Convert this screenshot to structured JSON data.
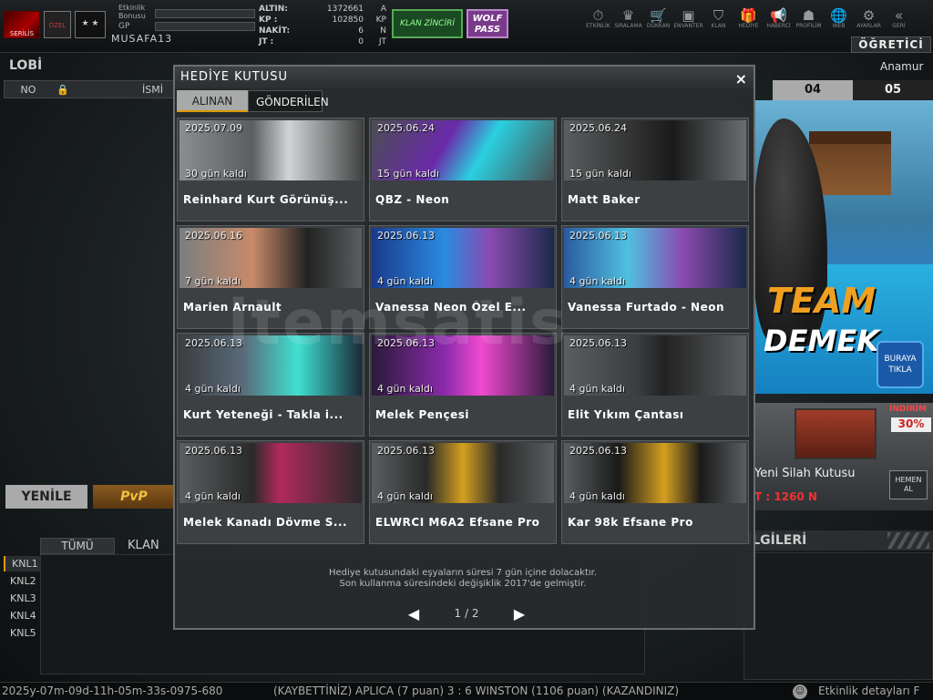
{
  "topbar": {
    "logo_text": "SERİLİS",
    "rank_badge": "ÖZEL",
    "stars": "★ ★",
    "event_bonus_label": "Etkinlik Bonusu",
    "gp_label": "GP",
    "username": "MUSAFA13",
    "currency": [
      {
        "key": "ALTIN:",
        "value": "1372661",
        "unit": "A"
      },
      {
        "key": "KP :",
        "value": "102850",
        "unit": "KP"
      },
      {
        "key": "NAKİT:",
        "value": "6",
        "unit": "N"
      },
      {
        "key": "JT :",
        "value": "0",
        "unit": "JT"
      }
    ],
    "klan_button": "KLAN ZİNCİRİ",
    "wolf_pass_button": "WOLF PASS",
    "nav": [
      {
        "label": "ETKİNLİK",
        "icon": "clock-icon"
      },
      {
        "label": "SIRALAMA",
        "icon": "ranking-icon"
      },
      {
        "label": "DÜKKAN",
        "icon": "cart-icon"
      },
      {
        "label": "ENVANTER",
        "icon": "inventory-icon"
      },
      {
        "label": "KLAN",
        "icon": "shield-icon"
      },
      {
        "label": "HEDİYE",
        "icon": "gift-icon"
      },
      {
        "label": "HABERCİ",
        "icon": "megaphone-icon"
      },
      {
        "label": "PROFİLİM",
        "icon": "profile-icon"
      },
      {
        "label": "WEB",
        "icon": "globe-icon"
      },
      {
        "label": "AYARLAR",
        "icon": "gear-icon"
      },
      {
        "label": "GERİ",
        "icon": "back-icon"
      }
    ],
    "tutorial_button": "ÖĞRETİCİ"
  },
  "lobby": {
    "title": "LOBİ",
    "server": "Anamur",
    "col_no": "NO",
    "col_name": "İSMİ",
    "room_tabs": [
      "04",
      "05"
    ],
    "refresh_button": "YENİLE",
    "mode_button": "PvP",
    "chat_tabs": [
      "TÜMÜ",
      "KLAN"
    ],
    "channels": [
      "KNL1",
      "KNL2",
      "KNL3",
      "KNL4",
      "KNL5"
    ],
    "info_header": "İLGİLERİ"
  },
  "promo": {
    "banner_line1": "TEAM",
    "banner_line2": "DEMEK",
    "click_here": "BURAYA TIKLA",
    "discount_label": "İNDİRİM",
    "discount_value": "30%",
    "item_name": "Yeni Silah Kutusu",
    "price": "T : 1260 N",
    "buy_now": "HEMEN AL"
  },
  "modal": {
    "title": "HEDİYE KUTUSU",
    "close": "×",
    "tabs": [
      {
        "label": "ALINAN",
        "active": true
      },
      {
        "label": "GÖNDERİLEN",
        "active": false
      }
    ],
    "items": [
      {
        "date": "2025.07.09",
        "left": "30 gün kaldı",
        "name": "Reinhard Kurt Görünüş..."
      },
      {
        "date": "2025.06.24",
        "left": "15 gün kaldı",
        "name": "QBZ - Neon"
      },
      {
        "date": "2025.06.24",
        "left": "15 gün kaldı",
        "name": "Matt Baker"
      },
      {
        "date": "2025.06.16",
        "left": "7 gün kaldı",
        "name": "Marien Arnault"
      },
      {
        "date": "2025.06.13",
        "left": "4 gün kaldı",
        "name": "Vanessa Neon Özel E..."
      },
      {
        "date": "2025.06.13",
        "left": "4 gün kaldı",
        "name": "Vanessa Furtado - Neon"
      },
      {
        "date": "2025.06.13",
        "left": "4 gün kaldı",
        "name": "Kurt Yeteneği - Takla i..."
      },
      {
        "date": "2025.06.13",
        "left": "4 gün kaldı",
        "name": "Melek Pençesi"
      },
      {
        "date": "2025.06.13",
        "left": "4 gün kaldı",
        "name": "Elit Yıkım Çantası"
      },
      {
        "date": "2025.06.13",
        "left": "4 gün kaldı",
        "name": "Melek Kanadı Dövme S..."
      },
      {
        "date": "2025.06.13",
        "left": "4 gün kaldı",
        "name": "ELWRCI M6A2 Efsane Pro"
      },
      {
        "date": "2025.06.13",
        "left": "4 gün kaldı",
        "name": "Kar 98k Efsane Pro"
      }
    ],
    "footnote_line1": "Hediye kutusundaki eşyaların süresi 7 gün içine dolacaktır.",
    "footnote_line2": "Son kullanma süresindeki değişiklik 2017'de gelmiştir.",
    "page": "1 / 2"
  },
  "watermark": "itemsatis",
  "ticker": {
    "timestamp": "2025y-07m-09d-11h-05m-33s-0975-680",
    "message": "(KAYBETTİNİZ) APLICA (7 puan) 3 : 6 WINSTON (1106 puan) (KAZANDINIZ)",
    "event_info": "Etkinlik detayları F"
  }
}
